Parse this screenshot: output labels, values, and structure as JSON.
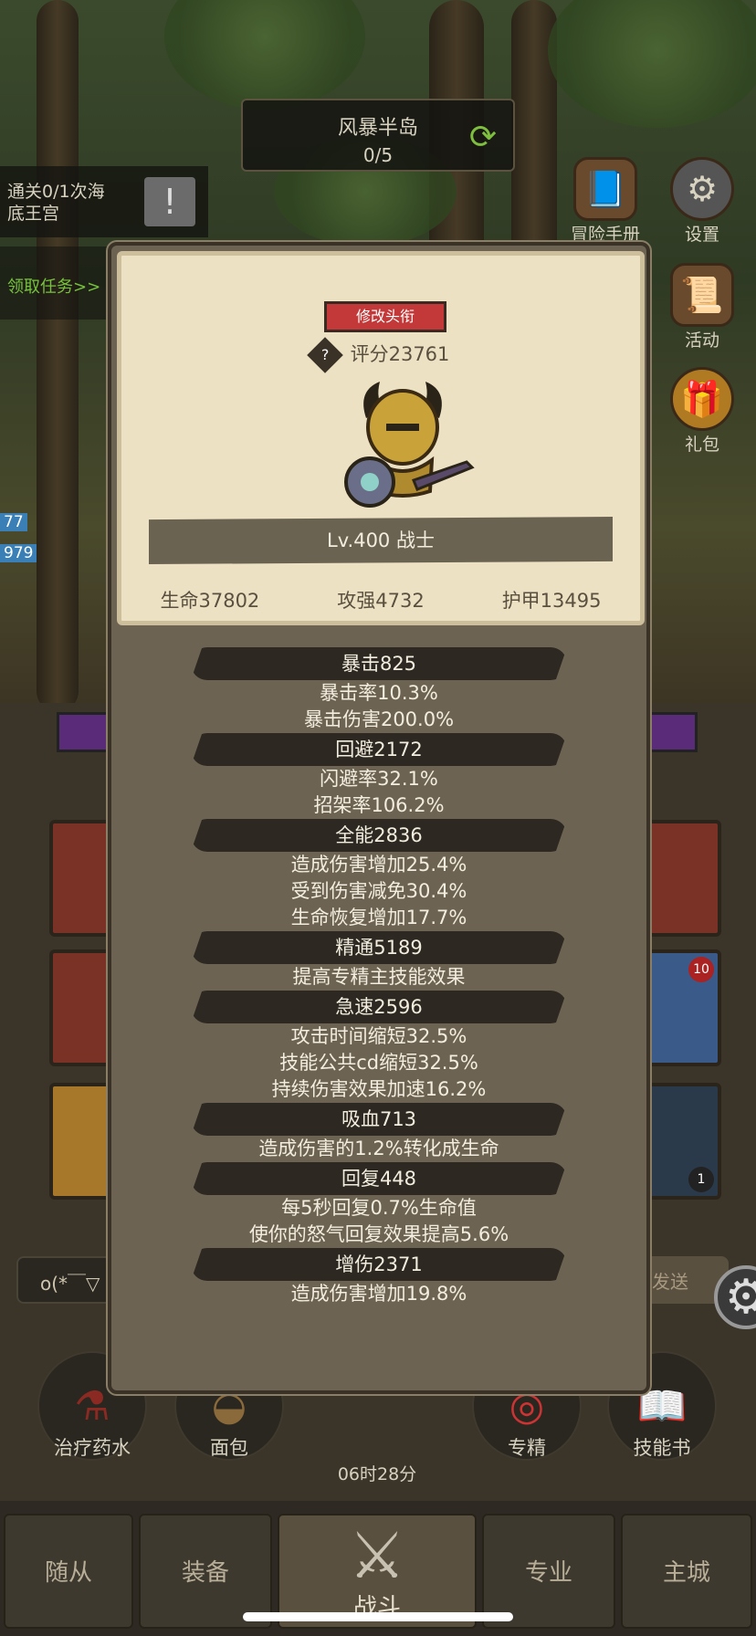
{
  "header": {
    "map_name": "风暴半岛",
    "map_progress": "0/5",
    "refresh_icon": "refresh-icon"
  },
  "quest": {
    "text_line1": "通关0/1次海",
    "text_line2": "底王宫",
    "claim_label": "领取任务>>",
    "button_icon": "exclaim-icon"
  },
  "side_menu": [
    {
      "label": "冒险手册",
      "icon": "book-icon"
    },
    {
      "label": "设置",
      "icon": "gear-icon"
    },
    {
      "label": "活动",
      "icon": "scroll-icon"
    },
    {
      "label": "礼包",
      "icon": "gift-icon"
    }
  ],
  "hp_tags": [
    "77",
    "979"
  ],
  "chat": {
    "placeholder_text": "o(*￣▽",
    "send_label": "发送"
  },
  "badges": {
    "slot_badge_1": "10",
    "slot_badge_2": "1"
  },
  "consumables": [
    {
      "label": "治疗药水",
      "icon": "potion-icon"
    },
    {
      "label": "面包",
      "icon": "bread-icon"
    },
    {
      "label": "专精",
      "icon": "spec-icon"
    },
    {
      "label": "技能书",
      "icon": "skillbook-icon"
    }
  ],
  "timer": "06时28分",
  "bottom_nav": [
    {
      "label": "随从",
      "active": false
    },
    {
      "label": "装备",
      "active": false
    },
    {
      "label": "战斗",
      "active": true
    },
    {
      "label": "专业",
      "active": false
    },
    {
      "label": "主城",
      "active": false
    }
  ],
  "popup": {
    "title_button": "修改头衔",
    "score": "评分23761",
    "level_class": "Lv.400 战士",
    "stats": {
      "hp": "生命37802",
      "attack": "攻强4732",
      "armor": "护甲13495"
    },
    "attributes": [
      {
        "name": "暴击825",
        "lines": [
          "暴击率10.3%",
          "暴击伤害200.0%"
        ]
      },
      {
        "name": "回避2172",
        "lines": [
          "闪避率32.1%",
          "招架率106.2%"
        ]
      },
      {
        "name": "全能2836",
        "lines": [
          "造成伤害增加25.4%",
          "受到伤害减免30.4%",
          "生命恢复增加17.7%"
        ]
      },
      {
        "name": "精通5189",
        "lines": [
          "提高专精主技能效果"
        ]
      },
      {
        "name": "急速2596",
        "lines": [
          "攻击时间缩短32.5%",
          "技能公共cd缩短32.5%",
          "持续伤害效果加速16.2%"
        ]
      },
      {
        "name": "吸血713",
        "lines": [
          "造成伤害的1.2%转化成生命"
        ]
      },
      {
        "name": "回复448",
        "lines": [
          "每5秒回复0.7%生命值",
          "使你的怒气回复效果提高5.6%"
        ]
      },
      {
        "name": "增伤2371",
        "lines": [
          "造成伤害增加19.8%"
        ]
      }
    ]
  }
}
